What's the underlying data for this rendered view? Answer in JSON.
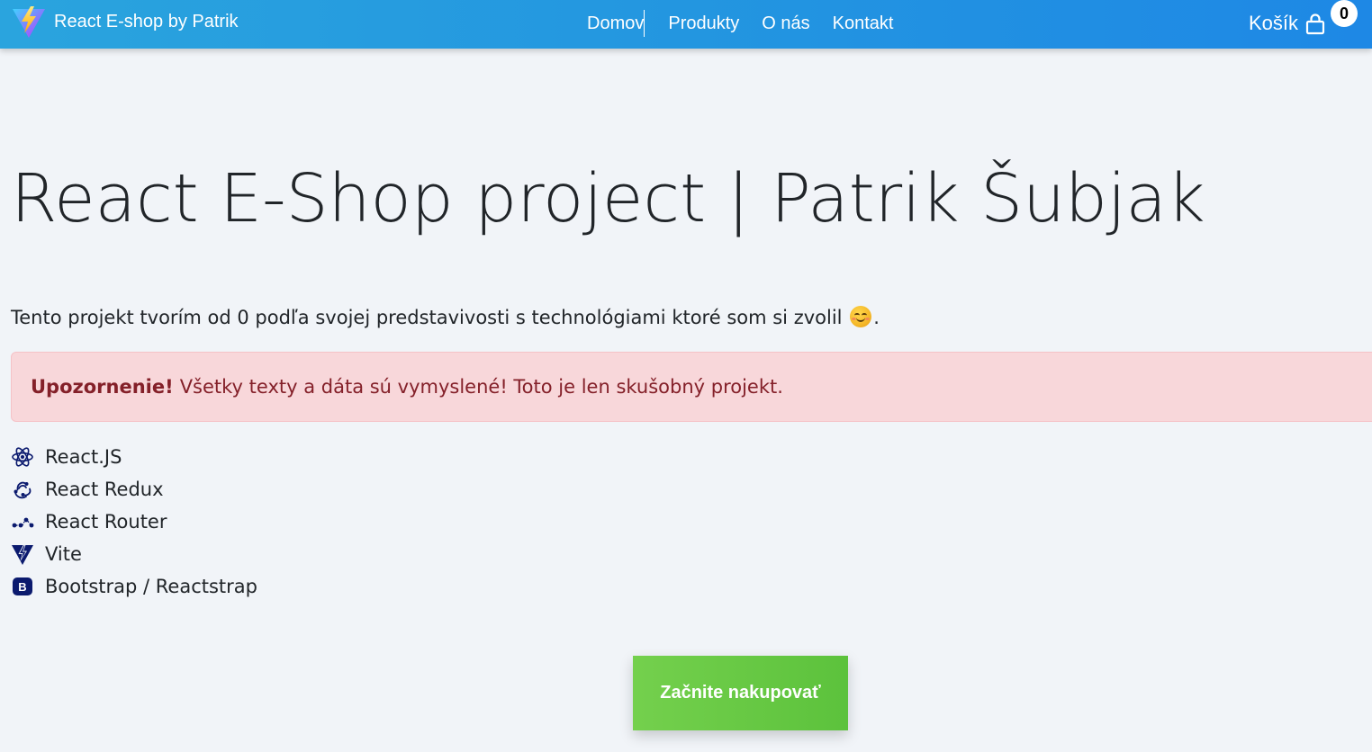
{
  "navbar": {
    "brand": "React E-shop by Patrik",
    "brand_icon": "vite-logo-icon",
    "links": [
      "Domov",
      "Produkty",
      "O nás",
      "Kontakt"
    ],
    "cart_label": "Košík",
    "cart_icon": "shopping-bag-icon",
    "cart_count": "0",
    "colors": {
      "gradient_start": "#2aa4de",
      "gradient_end": "#1e88e5"
    }
  },
  "hero": {
    "title": "React E-Shop project | Patrik Šubjak",
    "intro": "Tento projekt tvorím od 0 podľa svojej predstavivosti s technológiami ktoré som si zvolil",
    "intro_end": ".",
    "emoji": "smiling-face-icon"
  },
  "alert": {
    "strong": "Upozornenie!",
    "text": "Všetky texty a dáta sú vymyslené! Toto je len skušobný projekt.",
    "colors": {
      "background": "#f8d7da",
      "text": "#842029"
    }
  },
  "technologies": [
    {
      "label": "React.JS",
      "icon": "react-icon"
    },
    {
      "label": "React Redux",
      "icon": "redux-icon"
    },
    {
      "label": "React Router",
      "icon": "react-router-icon"
    },
    {
      "label": "Vite",
      "icon": "vite-icon"
    },
    {
      "label": "Bootstrap / Reactstrap",
      "icon": "bootstrap-icon"
    }
  ],
  "cta": {
    "label": "Začnite nakupovať",
    "color": "#5cc23c"
  }
}
